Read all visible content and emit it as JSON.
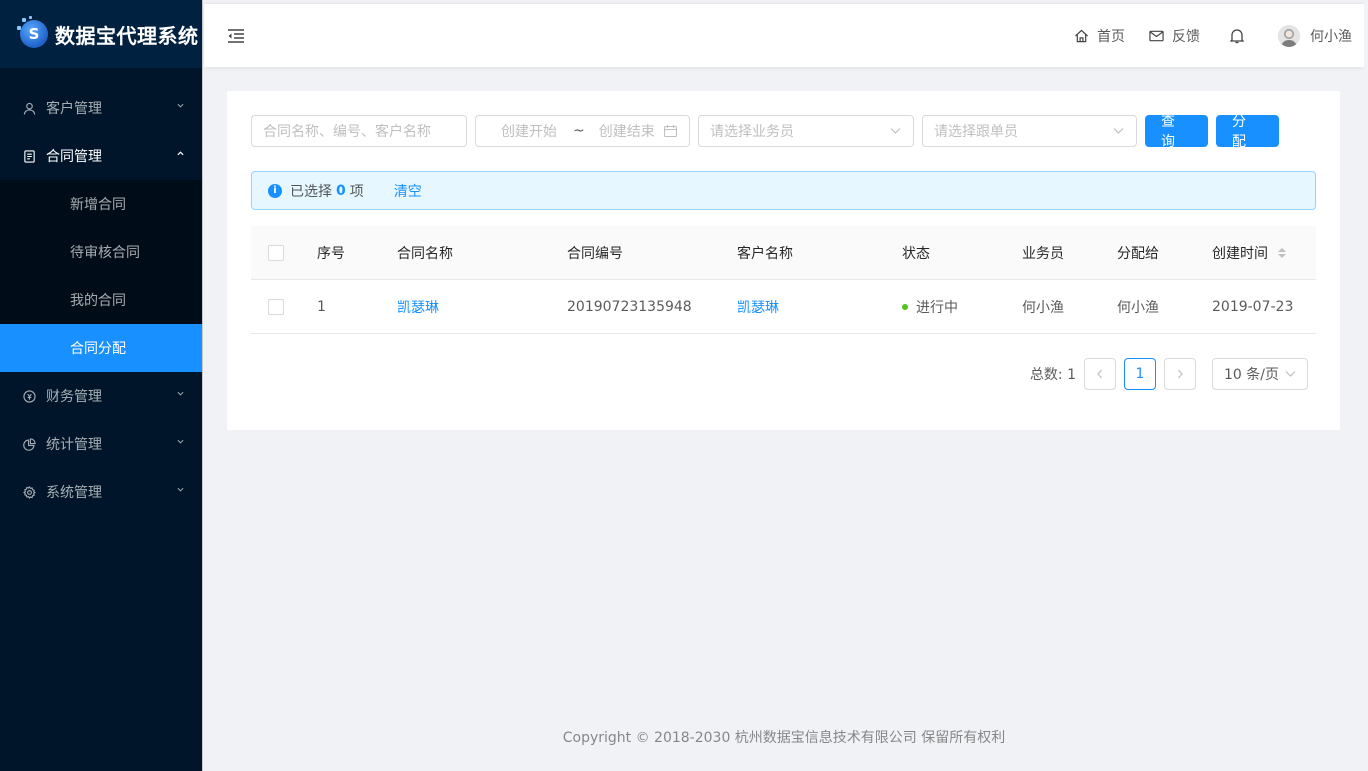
{
  "app": {
    "title": "数据宝代理系统"
  },
  "sidebar": {
    "items": [
      {
        "label": "客户管理",
        "icon": "user-icon"
      },
      {
        "label": "合同管理",
        "icon": "contract-icon",
        "open": true,
        "children": [
          {
            "label": "新增合同"
          },
          {
            "label": "待审核合同"
          },
          {
            "label": "我的合同"
          },
          {
            "label": "合同分配",
            "active": true
          }
        ]
      },
      {
        "label": "财务管理",
        "icon": "finance-icon"
      },
      {
        "label": "统计管理",
        "icon": "pie-chart-icon"
      },
      {
        "label": "系统管理",
        "icon": "gear-icon"
      }
    ]
  },
  "header": {
    "home_label": "首页",
    "feedback_label": "反馈",
    "user_name": "何小渔"
  },
  "search": {
    "contract_placeholder": "合同名称、编号、客户名称",
    "date_start_placeholder": "创建开始",
    "date_sep": "~",
    "date_end_placeholder": "创建结束",
    "salesman_placeholder": "请选择业务员",
    "follower_placeholder": "请选择跟单员",
    "query_label": "查 询",
    "assign_label": "分 配"
  },
  "alert": {
    "prefix": "已选择",
    "count": "0",
    "suffix": "项",
    "clear_label": "清空"
  },
  "table": {
    "columns": [
      "序号",
      "合同名称",
      "合同编号",
      "客户名称",
      "状态",
      "业务员",
      "分配给",
      "创建时间"
    ],
    "rows": [
      {
        "index": "1",
        "contract_name": "凯瑟琳",
        "contract_no": "20190723135948",
        "customer": "凯瑟琳",
        "status": "进行中",
        "salesman": "何小渔",
        "assigned_to": "何小渔",
        "created": "2019-07-23"
      }
    ]
  },
  "pagination": {
    "total_label": "总数: 1",
    "current_page": "1",
    "page_size": "10 条/页"
  },
  "footer": {
    "text": "Copyright © 2018-2030 杭州数据宝信息技术有限公司 保留所有权利"
  },
  "colors": {
    "primary": "#1890ff",
    "sider": "#001529",
    "success": "#52c41a"
  }
}
